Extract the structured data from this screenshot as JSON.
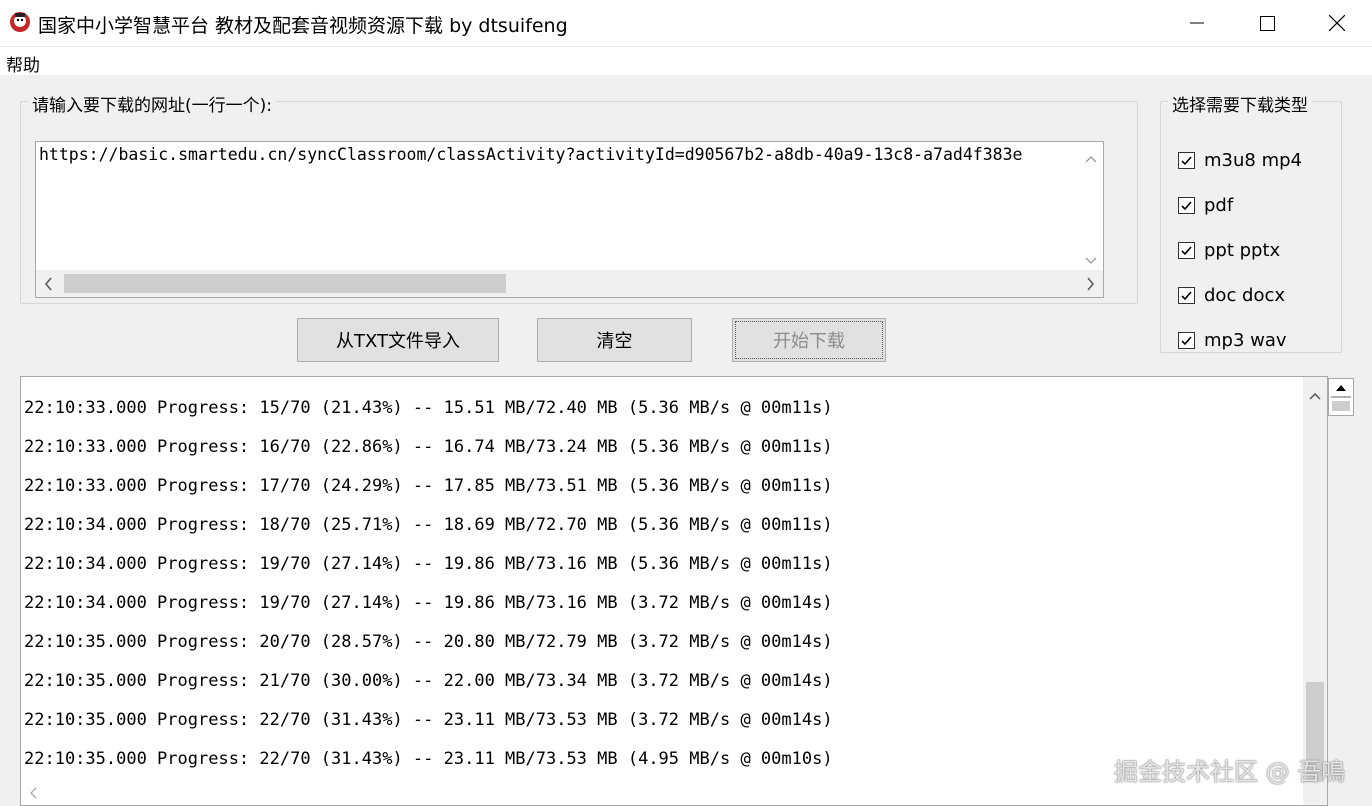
{
  "window": {
    "title": "国家中小学智慧平台 教材及配套音视频资源下载 by dtsuifeng"
  },
  "menu": {
    "items": [
      {
        "label": "帮助"
      }
    ]
  },
  "url_group": {
    "legend": "请输入要下载的网址(一行一个):",
    "value": "https://basic.smartedu.cn/syncClassroom/classActivity?activityId=d90567b2-a8db-40a9-13c8-a7ad4f383e"
  },
  "buttons": {
    "import": "从TXT文件导入",
    "clear": "清空",
    "start": "开始下载"
  },
  "types_group": {
    "legend": "选择需要下载类型",
    "options": [
      {
        "label": "m3u8 mp4",
        "checked": true
      },
      {
        "label": "pdf",
        "checked": true
      },
      {
        "label": "ppt pptx",
        "checked": true
      },
      {
        "label": "doc docx",
        "checked": true
      },
      {
        "label": "mp3 wav",
        "checked": true
      }
    ]
  },
  "log": {
    "lines": [
      "22:10:33.000 Progress: 15/70 (21.43%) -- 15.51 MB/72.40 MB (5.36 MB/s @ 00m11s)",
      "22:10:33.000 Progress: 16/70 (22.86%) -- 16.74 MB/73.24 MB (5.36 MB/s @ 00m11s)",
      "22:10:33.000 Progress: 17/70 (24.29%) -- 17.85 MB/73.51 MB (5.36 MB/s @ 00m11s)",
      "22:10:34.000 Progress: 18/70 (25.71%) -- 18.69 MB/72.70 MB (5.36 MB/s @ 00m11s)",
      "22:10:34.000 Progress: 19/70 (27.14%) -- 19.86 MB/73.16 MB (5.36 MB/s @ 00m11s)",
      "22:10:34.000 Progress: 19/70 (27.14%) -- 19.86 MB/73.16 MB (3.72 MB/s @ 00m14s)",
      "22:10:35.000 Progress: 20/70 (28.57%) -- 20.80 MB/72.79 MB (3.72 MB/s @ 00m14s)",
      "22:10:35.000 Progress: 21/70 (30.00%) -- 22.00 MB/73.34 MB (3.72 MB/s @ 00m14s)",
      "22:10:35.000 Progress: 22/70 (31.43%) -- 23.11 MB/73.53 MB (3.72 MB/s @ 00m14s)",
      "22:10:35.000 Progress: 22/70 (31.43%) -- 23.11 MB/73.53 MB (4.95 MB/s @ 00m10s)"
    ]
  },
  "watermark": "掘金技术社区 @ 吾鳴",
  "icons": {
    "app": "app-icon",
    "minimize": "minimize-icon",
    "maximize": "maximize-icon",
    "close": "close-icon"
  }
}
